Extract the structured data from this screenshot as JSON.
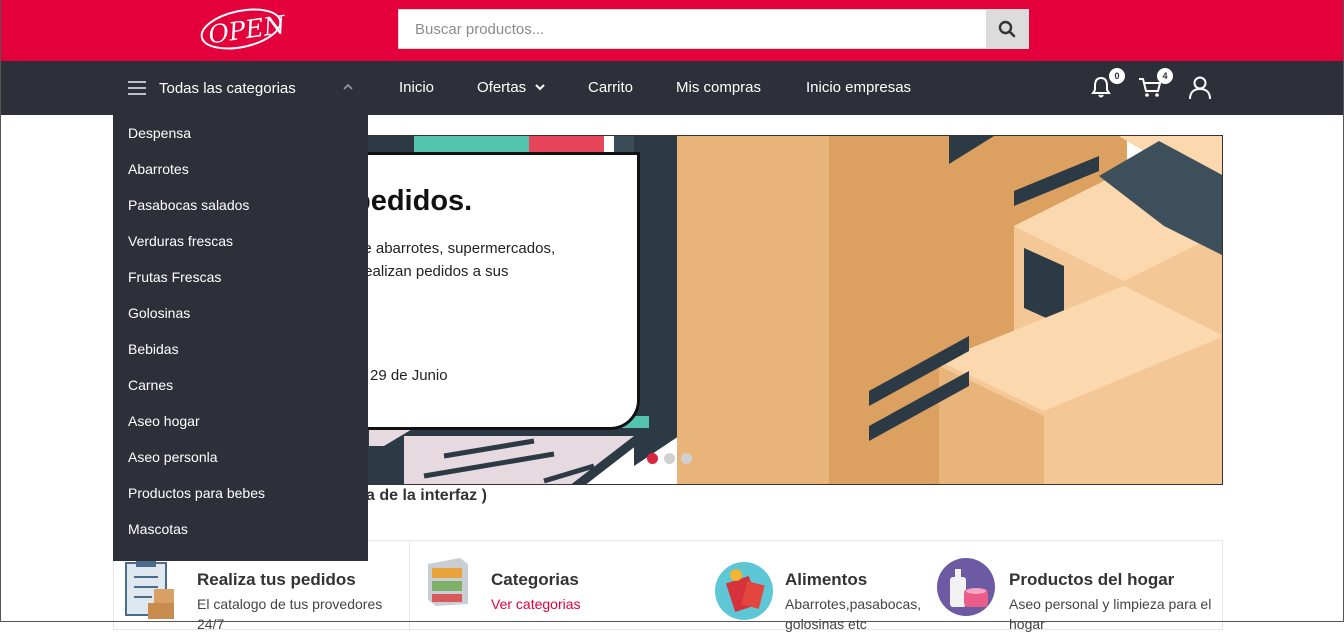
{
  "header": {
    "logo_text": "OPEN",
    "search_placeholder": "Buscar productos...",
    "brand_color": "#e4003a",
    "nav_color": "#2e3039"
  },
  "nav": {
    "categories_label": "Todas las categorias",
    "links": [
      "Inicio",
      "Ofertas",
      "Carrito",
      "Mis compras",
      "Inicio empresas"
    ],
    "notifications_count": "0",
    "cart_count": "4"
  },
  "categories": [
    "Despensa",
    "Abarrotes",
    "Pasabocas salados",
    "Verduras frescas",
    "Frutas Frescas",
    "Golosinas",
    "Bebidas",
    "Carnes",
    "Aseo hogar",
    "Aseo personla",
    "Productos para bebes",
    "Mascotas"
  ],
  "banner": {
    "title": "pedidos.",
    "text_line1": "as de abarrotes, supermercados,",
    "text_line2": "tas realizan pedidos a sus",
    "date": "29 de Junio",
    "active_slide": 1,
    "slide_count": 3,
    "caption": "a de la interfaz )"
  },
  "features": [
    {
      "title": "Realiza tus pedidos",
      "subtitle": "El catalogo de tus provedores",
      "subtitle2": "24/7",
      "icon": "checklist-icon"
    },
    {
      "title": "Categorias",
      "subtitle": "Ver categorias",
      "icon": "shelf-icon"
    },
    {
      "title": "Alimentos",
      "subtitle": "Abarrotes,pasabocas,",
      "subtitle2": "golosinas etc",
      "icon": "food-icon"
    },
    {
      "title": "Productos del hogar",
      "subtitle": "Aseo personal y limpieza para el",
      "subtitle2": "hogar",
      "icon": "cleaning-icon"
    }
  ]
}
